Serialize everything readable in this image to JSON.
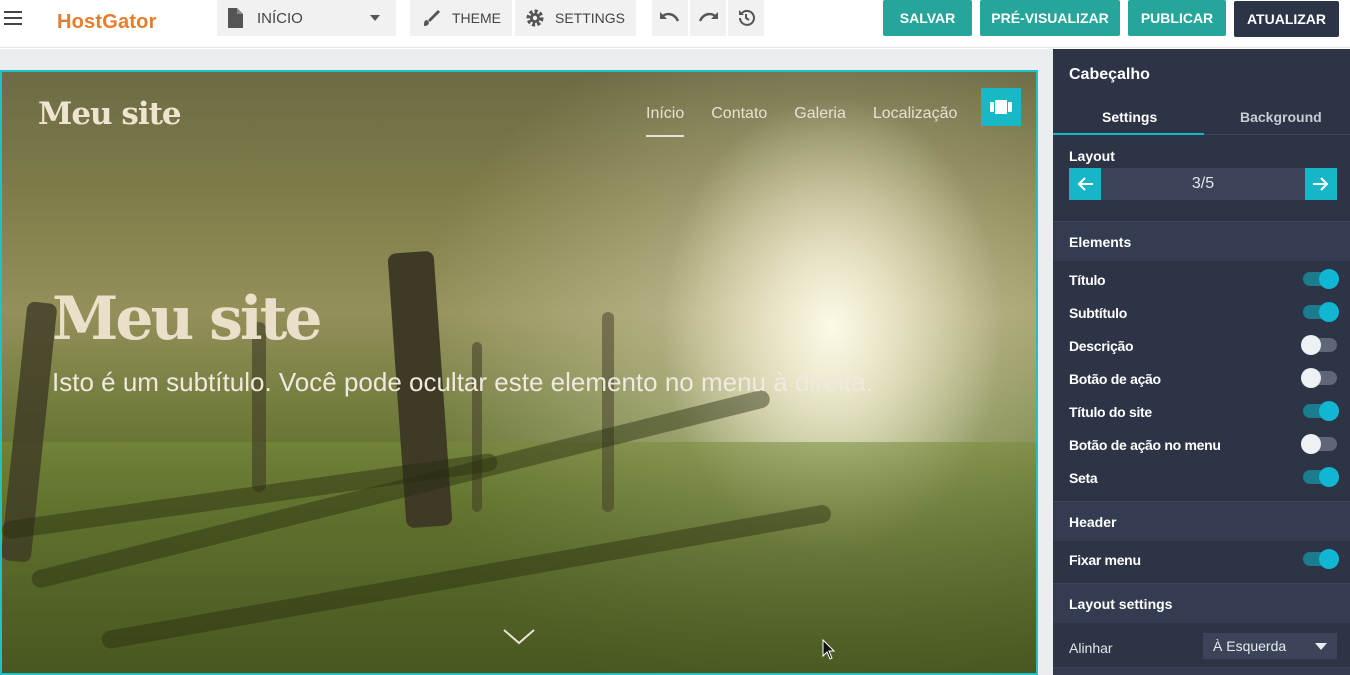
{
  "toolbar": {
    "logo": "HostGator",
    "page_select": "INÍCIO",
    "theme_label": "THEME",
    "settings_label": "SETTINGS",
    "save_label": "SALVAR",
    "preview_label": "PRÉ-VISUALIZAR",
    "publish_label": "PUBLICAR",
    "update_label": "ATUALIZAR"
  },
  "preview": {
    "site_title": "Meu site",
    "nav": [
      "Início",
      "Contato",
      "Galeria",
      "Localização"
    ],
    "hero_title": "Meu site",
    "hero_subtitle": "Isto é um subtítulo. Você pode ocultar este elemento no menu à direita."
  },
  "panel": {
    "title": "Cabeçalho",
    "tabs": [
      "Settings",
      "Background"
    ],
    "layout_heading": "Layout",
    "layout_value": "3/5",
    "elements_heading": "Elements",
    "elements": [
      {
        "label": "Título",
        "on": true
      },
      {
        "label": "Subtítulo",
        "on": true
      },
      {
        "label": "Descrição",
        "on": false
      },
      {
        "label": "Botão de ação",
        "on": false
      },
      {
        "label": "Título do site",
        "on": true
      },
      {
        "label": "Botão de ação no menu",
        "on": false
      },
      {
        "label": "Seta",
        "on": true
      }
    ],
    "header_heading": "Header",
    "fix_menu_label": "Fixar menu",
    "fix_menu_on": true,
    "layout_settings_heading": "Layout settings",
    "align_label": "Alinhar",
    "align_value": "À Esquerda"
  },
  "colors": {
    "accent": "#26a69a",
    "dark_button": "#2b3547",
    "panel_bg": "#2c3446",
    "highlight": "#17b5c8",
    "logo": "#e87c2a"
  }
}
